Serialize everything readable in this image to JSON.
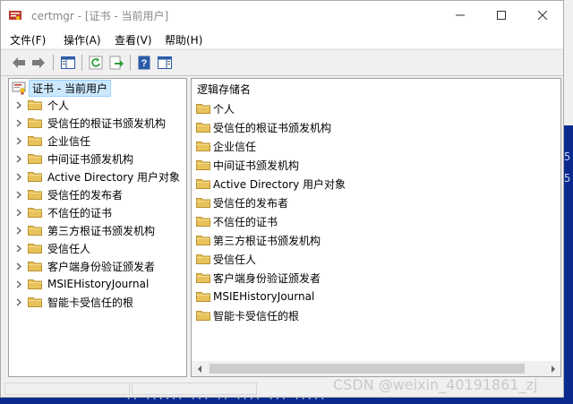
{
  "window": {
    "title": "certmgr - [证书 - 当前用户]",
    "controls": {
      "minimize": "minimize",
      "maximize": "maximize",
      "close": "close"
    }
  },
  "menu": [
    "文件(F)",
    "操作(A)",
    "查看(V)",
    "帮助(H)"
  ],
  "toolbar": {
    "buttons": [
      "back-arrow-icon",
      "forward-arrow-icon",
      "show-hide-console-tree-icon",
      "refresh-icon",
      "export-list-icon",
      "help-icon",
      "show-hide-action-pane-icon"
    ]
  },
  "tree": {
    "root": "证书 - 当前用户",
    "items": [
      "个人",
      "受信任的根证书颁发机构",
      "企业信任",
      "中间证书颁发机构",
      "Active Directory 用户对象",
      "受信任的发布者",
      "不信任的证书",
      "第三方根证书颁发机构",
      "受信任人",
      "客户端身份验证颁发者",
      "MSIEHistoryJournal",
      "智能卡受信任的根"
    ]
  },
  "list": {
    "column_header": "逻辑存储名",
    "items": [
      "个人",
      "受信任的根证书颁发机构",
      "企业信任",
      "中间证书颁发机构",
      "Active Directory 用户对象",
      "受信任的发布者",
      "不信任的证书",
      "第三方根证书颁发机构",
      "受信任人",
      "客户端身份验证颁发者",
      "MSIEHistoryJournal",
      "智能卡受信任的根"
    ]
  },
  "watermark": "CSDN @weixin_40191861_zj",
  "colors": {
    "selection": "#cce8ff",
    "folder": "#e8c25a",
    "background_console": "#0a2a8f"
  }
}
